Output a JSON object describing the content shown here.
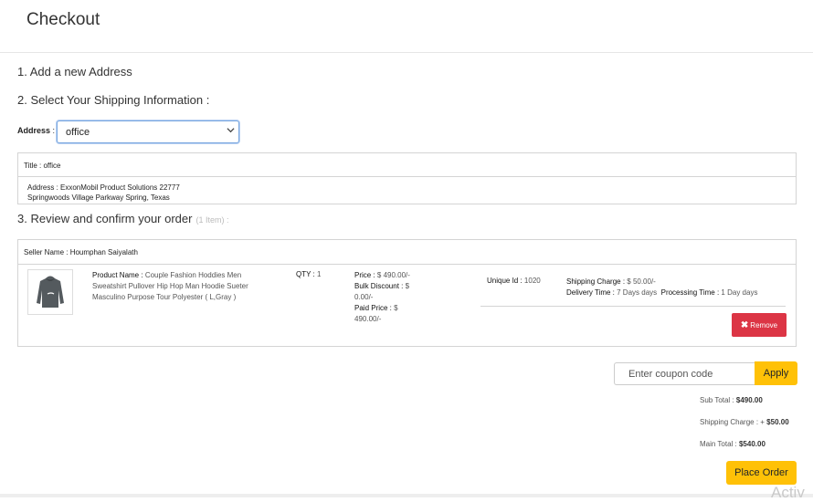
{
  "page": {
    "title": "Checkout"
  },
  "steps": {
    "add_address": "1. Add a new Address",
    "shipping": "2. Select Your Shipping Information :",
    "review": "3. Review and confirm your order",
    "review_count": "(1 Item) :"
  },
  "address": {
    "label": "Address",
    "label_colon": " :",
    "selected": "office",
    "title_label": "Title : ",
    "title_value": "office",
    "text": "Address : ExxonMobil Product Solutions 22777 Springwoods Village Parkway Spring, Texas"
  },
  "order": {
    "seller_label": "Seller Name : ",
    "seller_name": "Houmphan Saiyalath",
    "product_label": "Product Name : ",
    "product_name": "Couple Fashion Hoddies Men Sweatshirt Pullover Hip Hop Man Hoodie Sueter Masculino Purpose Tour Polyester ( L,Gray )",
    "qty_label": "QTY : ",
    "qty": "1",
    "price_label": "Price : ",
    "price": "$ 490.00/-",
    "bulk_label": "Bulk Discount : ",
    "bulk": "$ 0.00/-",
    "paid_label": "Paid Price : ",
    "paid": "$ 490.00/-",
    "unique_label": "Unique Id : ",
    "unique_id": "1020",
    "shipping_label": "Shipping Charge : ",
    "shipping": "$ 50.00/-",
    "delivery_label": "Delivery Time : ",
    "delivery": "7 Days days",
    "processing_label": "Processing Time : ",
    "processing": "1 Day days",
    "remove_label": "Remove",
    "remove_icon": "times-icon"
  },
  "coupon": {
    "placeholder": "Enter coupon code",
    "apply_label": "Apply"
  },
  "totals": {
    "sub_label": "Sub Total : ",
    "sub": "$490.00",
    "ship_label": "Shipping Charge : + ",
    "ship": "$50.00",
    "main_label": "Main Total : ",
    "main": "$540.00"
  },
  "place_order_label": "Place Order",
  "watermark": "Activ",
  "colors": {
    "remove": "#dc3545",
    "accent": "#ffc107",
    "focus_border": "#7aa7e0"
  }
}
